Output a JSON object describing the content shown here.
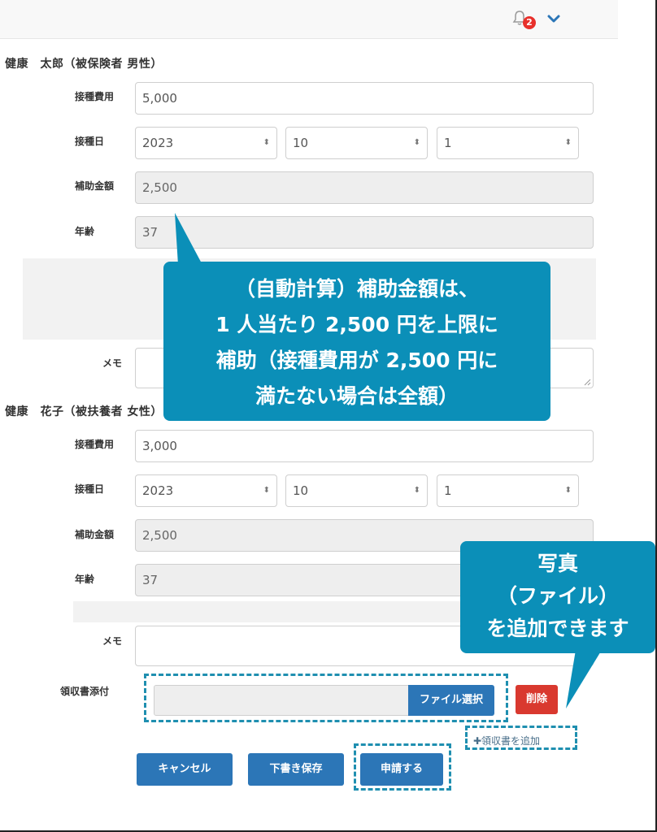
{
  "header": {
    "notification_count": "2"
  },
  "persons": [
    {
      "title": "健康　太郎（被保険者 男性）",
      "fee_label": "接種費用",
      "fee_value": "5,000",
      "date_label": "接種日",
      "year": "2023",
      "month": "10",
      "day": "1",
      "subsidy_label": "補助金額",
      "subsidy_value": "2,500",
      "age_label": "年齢",
      "age_value": "37",
      "memo_label": "メモ"
    },
    {
      "title": "健康　花子（被扶養者 女性）",
      "fee_label": "接種費用",
      "fee_value": "3,000",
      "date_label": "接種日",
      "year": "2023",
      "month": "10",
      "day": "1",
      "subsidy_label": "補助金額",
      "subsidy_value": "2,500",
      "age_label": "年齢",
      "age_value": "37",
      "memo_label": "メモ"
    }
  ],
  "receipt": {
    "label": "領収書添付",
    "file_select_label": "ファイル選択",
    "delete_label": "削除",
    "add_label": "✚領収書を追加"
  },
  "actions": {
    "cancel_label": "キャンセル",
    "draft_label": "下書き保存",
    "submit_label": "申請する"
  },
  "callouts": {
    "subsidy_note": [
      "（自動計算）補助金額は、",
      "1 人当たり 2,500 円を上限に",
      "補助（接種費用が 2,500 円に",
      "満たない場合は全額）"
    ],
    "photo_note": [
      "写真",
      "（ファイル）",
      "を追加できます"
    ]
  },
  "colors": {
    "primary": "#2c76b7",
    "danger": "#d9392f",
    "callout": "#0b8fb8",
    "badge": "#e8302b"
  }
}
